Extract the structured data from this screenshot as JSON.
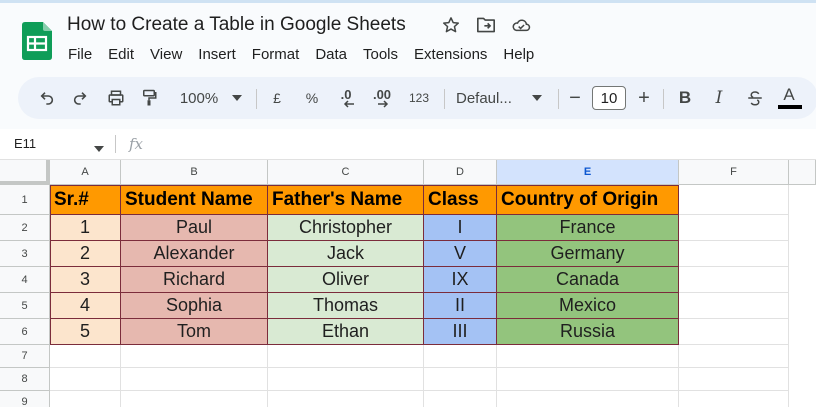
{
  "app": {
    "doc_title": "How to Create a Table in Google Sheets",
    "menu": [
      "File",
      "Edit",
      "View",
      "Insert",
      "Format",
      "Data",
      "Tools",
      "Extensions",
      "Help"
    ]
  },
  "toolbar": {
    "zoom": "100%",
    "currency": "£",
    "percent": "%",
    "decrease_decimal": ".0",
    "increase_decimal": ".00",
    "number_format": "123",
    "font": "Defaul...",
    "font_size": "10",
    "minus": "−",
    "plus": "+",
    "bold": "B",
    "italic": "I",
    "text_color": "A"
  },
  "formula_bar": {
    "name_box": "E11",
    "fx": "fx"
  },
  "sheet": {
    "columns": [
      "A",
      "B",
      "C",
      "D",
      "E",
      "F"
    ],
    "selected_column": "E",
    "row_numbers": [
      "1",
      "2",
      "3",
      "4",
      "5",
      "6",
      "7",
      "8",
      "9"
    ],
    "headers": [
      "Sr.#",
      "Student Name",
      "Father's Name",
      "Class",
      "Country of Origin"
    ],
    "rows": [
      [
        "1",
        "Paul",
        "Christopher",
        "I",
        "France"
      ],
      [
        "2",
        "Alexander",
        "Jack",
        "V",
        "Germany"
      ],
      [
        "3",
        "Richard",
        "Oliver",
        "IX",
        "Canada"
      ],
      [
        "4",
        "Sophia",
        "Thomas",
        "II",
        "Mexico"
      ],
      [
        "5",
        "Tom",
        "Ethan",
        "III",
        "Russia"
      ]
    ]
  },
  "colors": {
    "header_fill": "#ff9900",
    "col_a_fill": "#fce5cd",
    "col_b_fill": "#e6b8af",
    "col_c_fill": "#d9ead3",
    "col_d_fill": "#a4c2f4",
    "col_e_fill": "#93c47d",
    "table_border": "#7b2c3b",
    "sheets_green": "#0f9d58"
  }
}
